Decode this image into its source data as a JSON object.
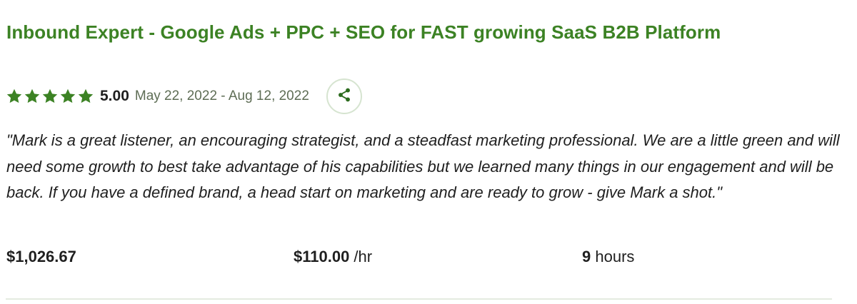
{
  "job": {
    "title": "Inbound Expert - Google Ads + PPC + SEO for FAST growing SaaS B2B Platform"
  },
  "feedback": {
    "stars": 5,
    "rating": "5.00",
    "date_range": "May 22, 2022 - Aug 12, 2022",
    "share_icon": "share-icon",
    "review": "\"Mark is a great listener, an encouraging strategist, and a steadfast marketing professional. We are a little green and will need some growth to best take advantage of his capabilities but we learned many things in our engagement and will be back. If you have a defined brand, a head start on marketing and are ready to grow - give Mark a shot.\""
  },
  "stats": {
    "total_earned": "$1,026.67",
    "rate_amount": "$110.00",
    "rate_unit": " /hr",
    "hours_count": "9",
    "hours_label": " hours"
  },
  "colors": {
    "brand_green": "#3c8224",
    "text": "#1f1f1f",
    "muted": "#5e6d55",
    "divider": "#e4ebe0"
  }
}
